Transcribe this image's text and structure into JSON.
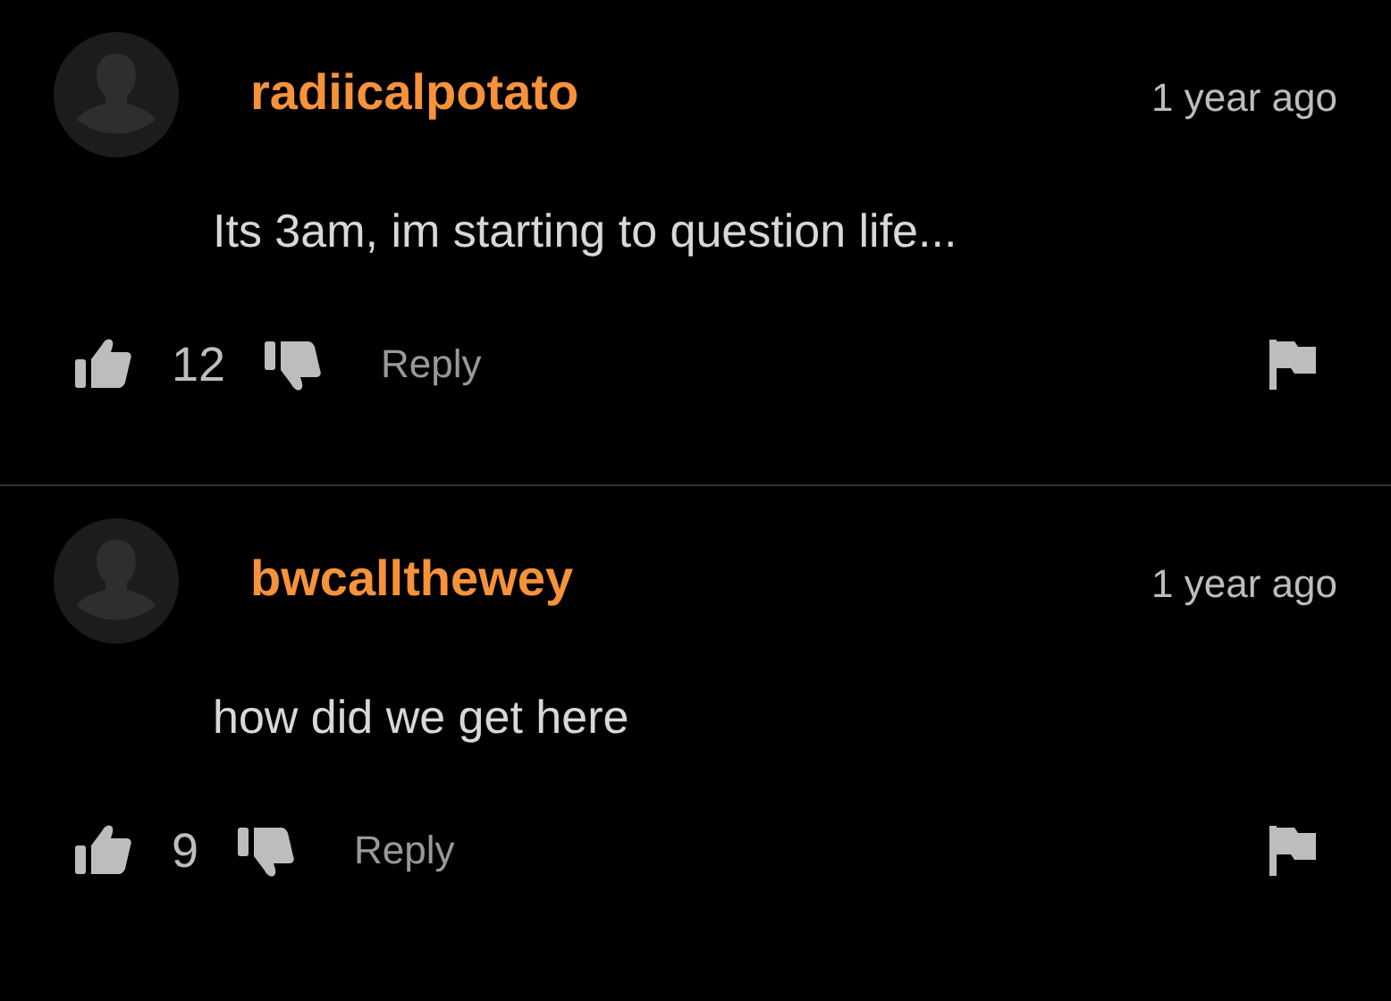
{
  "comments": [
    {
      "username": "radiicalpotato",
      "time": "1 year ago",
      "text": "Its 3am, im starting to question life...",
      "likes": "12",
      "reply": "Reply"
    },
    {
      "username": "bwcallthewey",
      "time": "1 year ago",
      "text": "how did we get here",
      "likes": "9",
      "reply": "Reply"
    }
  ]
}
